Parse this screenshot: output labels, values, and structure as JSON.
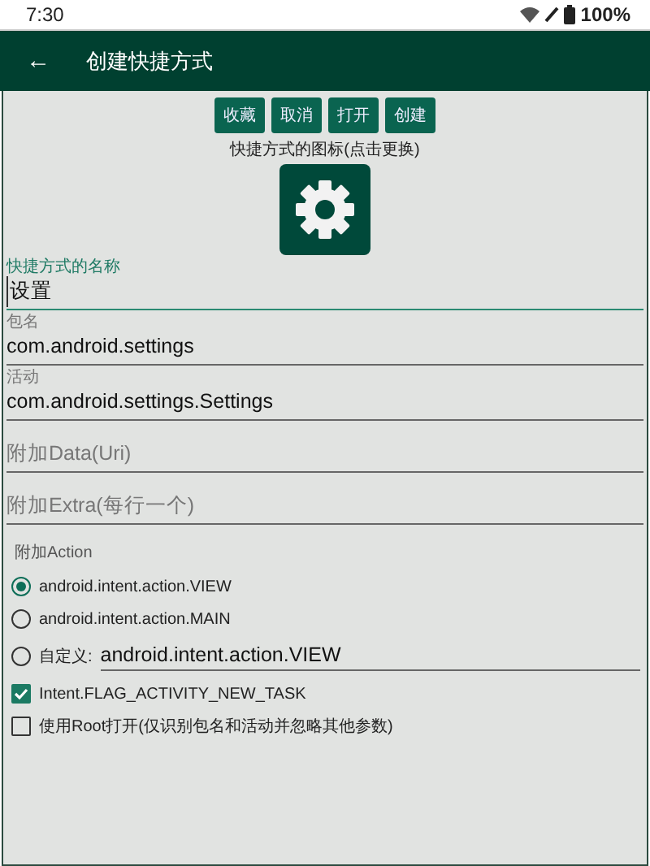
{
  "status_bar": {
    "time": "7:30",
    "battery": "100%"
  },
  "app_bar": {
    "back": "←",
    "title": "创建快捷方式"
  },
  "buttons": [
    "收藏",
    "取消",
    "打开",
    "创建"
  ],
  "icon_caption": "快捷方式的图标(点击更换)",
  "fields": [
    {
      "label": "快捷方式的名称",
      "value": "设置",
      "focused": true
    },
    {
      "label": "包名",
      "value": "com.android.settings",
      "focused": false
    },
    {
      "label": "活动",
      "value": "com.android.settings.Settings",
      "focused": false
    },
    {
      "placeholder": "附加Data(Uri)",
      "focused": false
    },
    {
      "placeholder": "附加Extra(每行一个)",
      "focused": false
    }
  ],
  "action_label": "附加Action",
  "actions": [
    {
      "kind": "option",
      "label": "android.intent.action.VIEW",
      "selected": true
    },
    {
      "kind": "option",
      "label": "android.intent.action.MAIN",
      "selected": false
    },
    {
      "kind": "custom",
      "label": "自定义:",
      "value": "android.intent.action.VIEW",
      "selected": false
    }
  ],
  "checkboxes": [
    {
      "label": "Intent.FLAG_ACTIVITY_NEW_TASK",
      "checked": true
    },
    {
      "label": "使用Root打开(仅识别包名和活动并忽略其他参数)",
      "checked": false
    }
  ]
}
